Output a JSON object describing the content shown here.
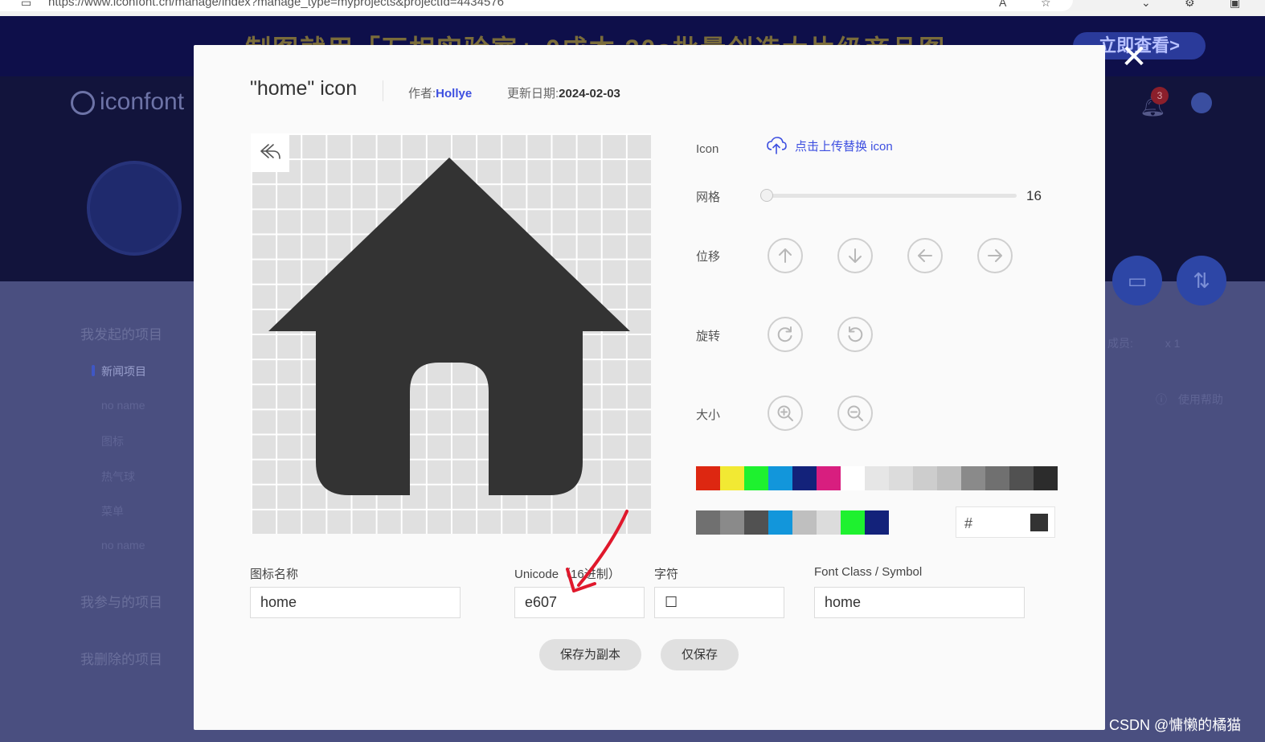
{
  "browser": {
    "url": "https://www.iconfont.cn/manage/index?manage_type=myprojects&projectId=4434576"
  },
  "background": {
    "banner_text": "制图就用「万相实验室」0成本 30s批量创造大片级商品图",
    "banner_button": "立即查看>",
    "logo_text": "iconfont",
    "notification_count": "3",
    "sidebar": {
      "my_projects": "我发起的项目",
      "items": [
        "新闻项目",
        "no name",
        "图标",
        "热气球",
        "菜单",
        "no name"
      ],
      "joined_projects": "我参与的项目",
      "deleted_projects": "我删除的项目"
    },
    "members_label": "成员:",
    "members_count": "x 1",
    "help_label": "使用帮助"
  },
  "modal": {
    "title": "\"home\"  icon",
    "author_label": "作者:",
    "author": "Hollye",
    "date_label": "更新日期:",
    "date": "2024-02-03",
    "icon_label": "Icon",
    "upload_text": "点击上传替换 icon",
    "grid_label": "网格",
    "grid_value": 16,
    "move_label": "位移",
    "rotate_label": "旋转",
    "size_label": "大小",
    "palette_row1": [
      "#dd2711",
      "#f2e933",
      "#1ef12f",
      "#1296db",
      "#13227a",
      "#d81e7f",
      "#ffffff",
      "#e6e6e6",
      "#dcdcdc",
      "#cdcdcd",
      "#bfbfbf",
      "#8a8a8a",
      "#707070",
      "#515151",
      "#2c2c2c"
    ],
    "palette_row2": [
      "#707070",
      "#8a8a8a",
      "#515151",
      "#1296db",
      "#bfbfbf",
      "#dcdcdc",
      "#1ef12f",
      "#13227a"
    ],
    "hex_prefix": "#",
    "current_color": "#333333",
    "fields": {
      "name_label": "图标名称",
      "name_value": "home",
      "unicode_label": "Unicode（16进制）",
      "unicode_value": "e607",
      "char_label": "字符",
      "char_value": "☐",
      "class_label": "Font Class / Symbol",
      "class_value": "home"
    },
    "save_copy_button": "保存为副本",
    "save_button": "仅保存",
    "close_symbol": "✕"
  },
  "watermark": "CSDN @慵懒的橘猫"
}
